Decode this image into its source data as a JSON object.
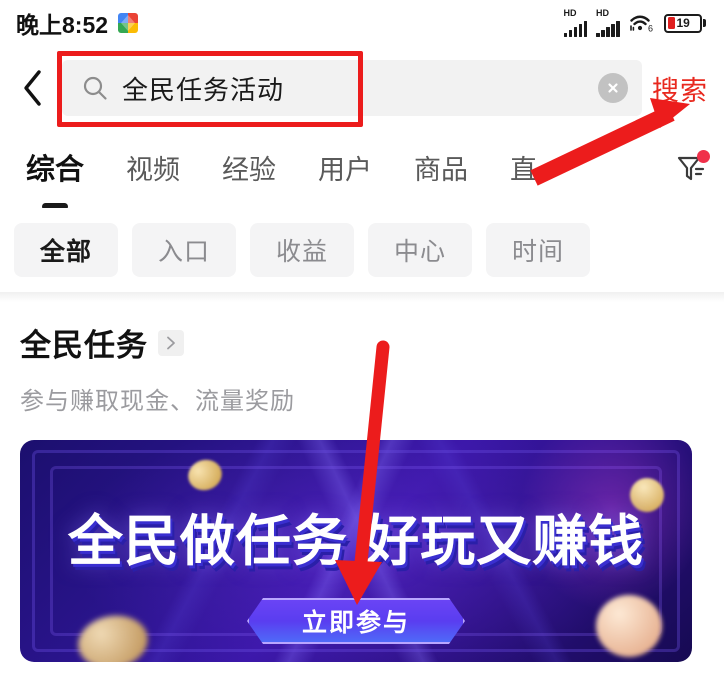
{
  "status_bar": {
    "time": "晚上8:52",
    "app_badge_icon": "colorful-app-icon",
    "network_label_1": "HD",
    "network_label_2": "HD",
    "wifi_icon": "wifi-6-icon",
    "wifi_generation": "6",
    "battery_level": "19"
  },
  "header": {
    "back_icon": "chevron-left-icon",
    "search_icon": "search-icon",
    "query": "全民任务活动",
    "placeholder": "搜索",
    "clear_icon": "close-circle-icon",
    "search_action_label": "搜索",
    "search_action_color": "#e8281e"
  },
  "tabs": {
    "items": [
      {
        "label": "综合",
        "active": true
      },
      {
        "label": "视频",
        "active": false
      },
      {
        "label": "经验",
        "active": false
      },
      {
        "label": "用户",
        "active": false
      },
      {
        "label": "商品",
        "active": false
      },
      {
        "label": "直",
        "active": false
      }
    ],
    "filter_icon": "filter-funnel-icon",
    "filter_badge": true,
    "badge_color": "#f0304a"
  },
  "chips": {
    "items": [
      {
        "label": "全部",
        "active": true
      },
      {
        "label": "入口",
        "active": false
      },
      {
        "label": "收益",
        "active": false
      },
      {
        "label": "中心",
        "active": false
      },
      {
        "label": "时间",
        "active": false
      }
    ]
  },
  "result": {
    "title": "全民任务",
    "chevron_icon": "chevron-right-icon",
    "subtitle": "参与赚取现金、流量奖励"
  },
  "banner": {
    "headline": "全民做任务 好玩又赚钱",
    "cta_label": "立即参与",
    "background_color": "#2a148c",
    "cta_color": "#5a3df0"
  },
  "annotations": {
    "highlight_box_color": "#ec1c1c",
    "arrow_1_target": "搜索",
    "arrow_2_target": "立即参与"
  }
}
